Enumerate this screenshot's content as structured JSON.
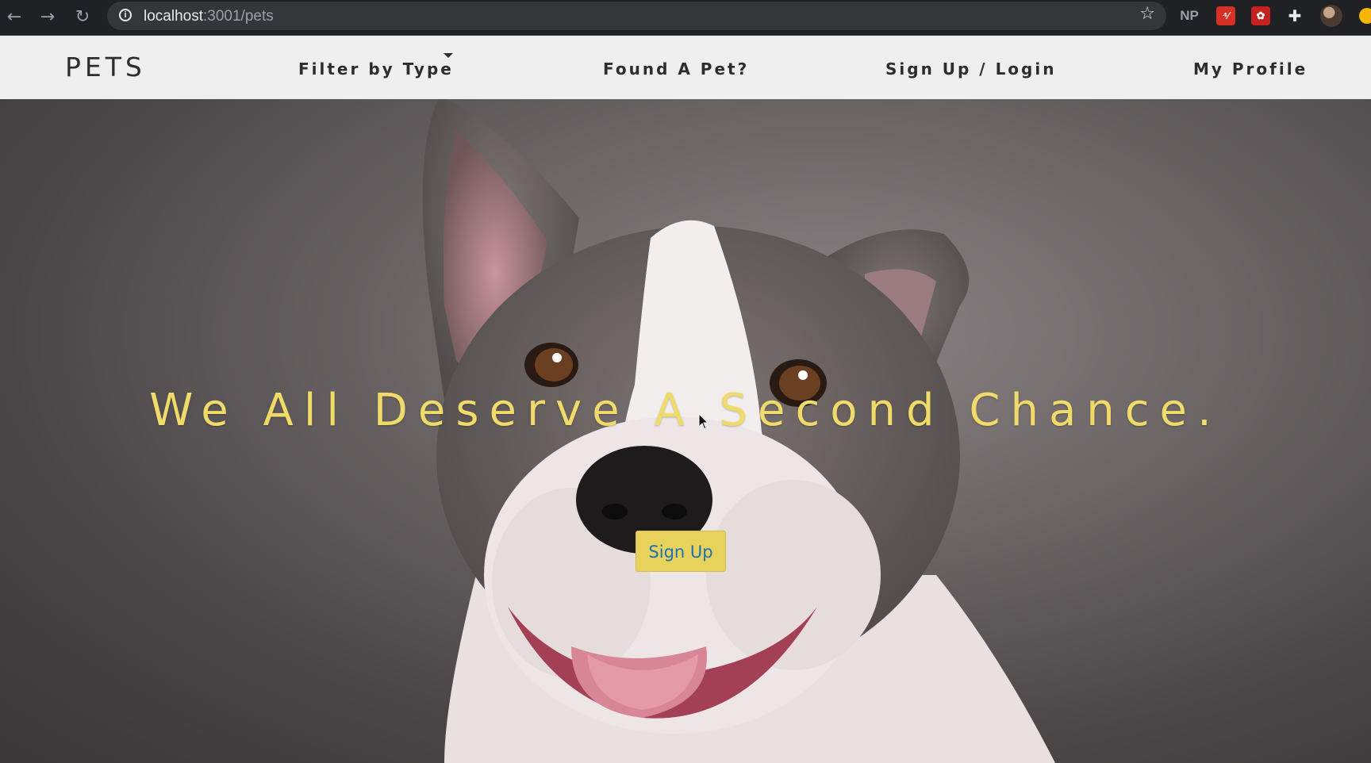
{
  "browser": {
    "url_host": "localhost",
    "url_path": ":3001/pets",
    "extensions": {
      "np_label": "NP",
      "ext_a_label": "⁴⁄",
      "ext_b_label": "✿"
    }
  },
  "navbar": {
    "brand": "PETS",
    "filter_label": "Filter by Type",
    "found_label": "Found A Pet?",
    "signup_label": "Sign Up / Login",
    "profile_label": "My Profile"
  },
  "hero": {
    "headline": "We All Deserve A Second Chance.",
    "cta_label": "Sign Up"
  },
  "colors": {
    "headline": "#f0db6a",
    "cta_bg": "#e7d35b",
    "cta_text": "#1d6fb8",
    "navbar_bg": "#efefef"
  }
}
